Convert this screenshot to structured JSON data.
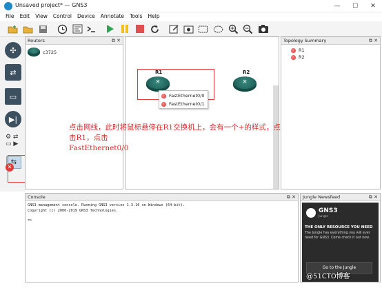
{
  "window": {
    "title": "Unsaved project* — GNS3",
    "minimize": "—",
    "maximize": "☐",
    "close": "✕"
  },
  "menu": [
    "File",
    "Edit",
    "View",
    "Control",
    "Device",
    "Annotate",
    "Tools",
    "Help"
  ],
  "routers_panel": {
    "title": "Routers",
    "items": [
      {
        "label": "c3725"
      }
    ]
  },
  "canvas": {
    "nodes": [
      {
        "label": "R1"
      },
      {
        "label": "R2"
      }
    ],
    "interfaces": [
      "FastEthernet0/0",
      "FastEthernet0/1"
    ]
  },
  "annotation": {
    "line1": "点击网线，此时将鼠标悬停在R1交换机上，会有一个+的样式，点击R1，点击",
    "line2": "FastEthernet0/0"
  },
  "topology": {
    "title": "Topology Summary",
    "items": [
      "R1",
      "R2"
    ]
  },
  "console": {
    "title": "Console",
    "lines": [
      "GNS3 management console. Running GNS3 version 1.3.10 on Windows (64-bit).",
      "Copyright (c) 2006-2019 GNS3 Technologies.",
      "",
      "=>"
    ]
  },
  "jungle": {
    "title": "Jungle Newsfeed",
    "brand": "GNS3",
    "brand_sub": "Jungle",
    "headline": "THE ONLY RESOURCE YOU NEED",
    "body": "The Jungle has everything you will ever need for GNS3. Come check it out now.",
    "button": "Go to the Jungle"
  },
  "watermark": "@51CTO博客",
  "colors": {
    "annotation": "#d92b2b",
    "router": "#1d5f58",
    "interface_dot": "#d22b2b",
    "toolbar_green": "#2ea44f",
    "toolbar_yellow": "#f0c020",
    "toolbar_red": "#e05050",
    "jungle_bg": "#2b2b2b"
  }
}
